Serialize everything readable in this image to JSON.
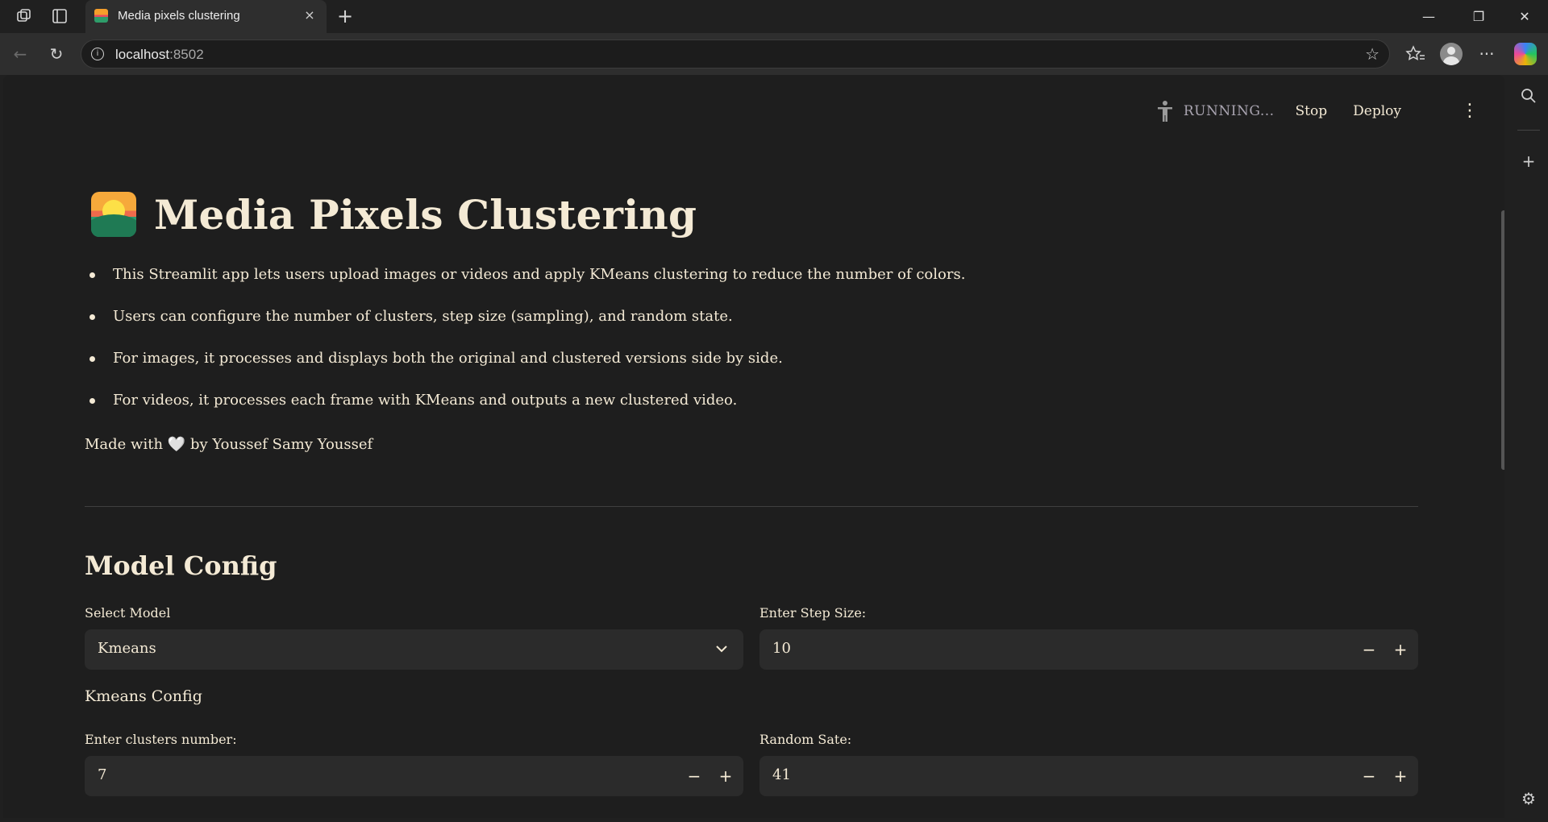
{
  "browser": {
    "tab_title": "Media pixels clustering",
    "url_host": "localhost",
    "url_port": ":8502",
    "icons": {
      "workspaces": "workspaces-icon",
      "tab_actions": "vertical-tabs-icon",
      "close_tab": "×",
      "new_tab": "+",
      "minimize": "—",
      "maximize": "❐",
      "close_window": "✕",
      "back": "←",
      "refresh": "↻",
      "favorite": "☆",
      "favorites": "☆≡",
      "more": "···",
      "search": "⌕",
      "add": "+",
      "settings": "⚙"
    }
  },
  "header": {
    "status": "RUNNING...",
    "stop_label": "Stop",
    "deploy_label": "Deploy",
    "menu_icon": "⋮",
    "run_icon": "☗"
  },
  "main": {
    "title": "Media Pixels Clustering",
    "bullets": [
      "This Streamlit app lets users upload images or videos and apply KMeans clustering to reduce the number of colors.",
      "Users can configure the number of clusters, step size (sampling), and random state.",
      "For images, it processes and displays both the original and clustered versions side by side.",
      "For videos, it processes each frame with KMeans and outputs a new clustered video."
    ],
    "madewith_prefix": "Made with",
    "heart": "🤍",
    "madewith_suffix": "by Youssef Samy Youssef",
    "section_title": "Model Config",
    "select_model_label": "Select Model",
    "select_model_value": "Kmeans",
    "step_size_label": "Enter Step Size:",
    "step_size_value": "10",
    "kmeans_config_label": "Kmeans Config",
    "clusters_label": "Enter clusters number:",
    "clusters_value": "7",
    "random_state_label": "Random Sate:",
    "random_state_value": "41",
    "minus": "−",
    "plus": "+",
    "chevron": "⌄"
  }
}
